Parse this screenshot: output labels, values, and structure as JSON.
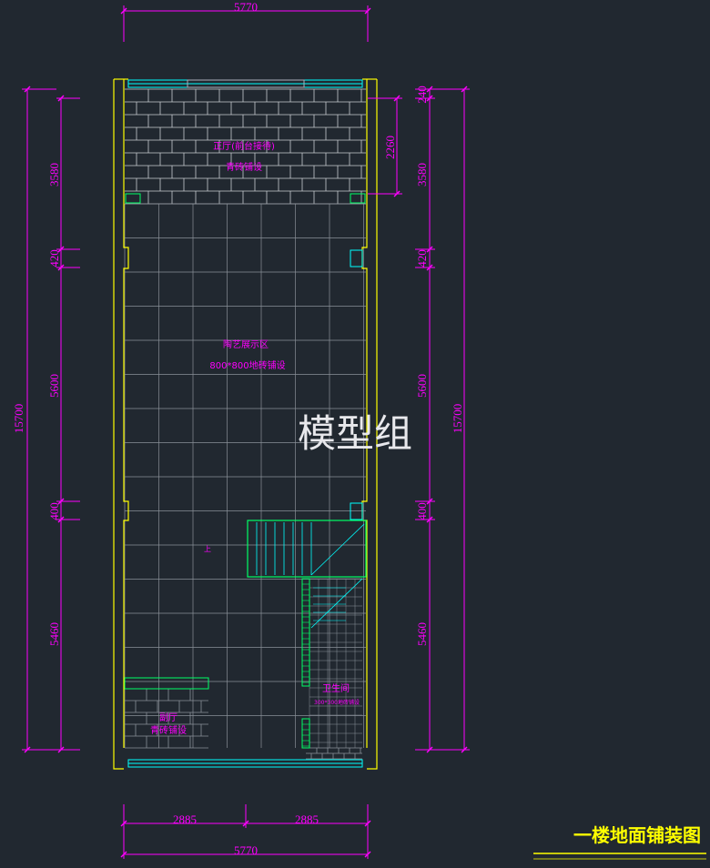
{
  "drawing": {
    "title": "一楼地面铺装图",
    "watermark": "模型组",
    "colors": {
      "background": "#212830",
      "dimension": "#ff00ff",
      "wall": "#ffff00",
      "window": "#00ffff",
      "grid": "#8a9099",
      "stair": "#00ff66",
      "text": "#ff00ff"
    }
  },
  "dimensions": {
    "top_total": "5770",
    "bottom_total": "5770",
    "bottom_left": "2885",
    "bottom_right": "2885",
    "left_total": "15700",
    "left_segments": [
      "3580",
      "420",
      "5600",
      "400",
      "5460"
    ],
    "right_total": "15700",
    "right_segments": [
      "240",
      "3580",
      "420",
      "5600",
      "400",
      "5460"
    ],
    "right_inner": "2260"
  },
  "rooms": {
    "reception": {
      "name": "正厅(前台接待)",
      "floor": "青砖铺设"
    },
    "exhibition": {
      "name": "陶艺展示区",
      "floor": "800*800地砖铺设"
    },
    "stair_label": "上",
    "bathroom": {
      "name": "卫生间",
      "floor": "300*300地砖铺设"
    },
    "side_hall": {
      "name": "副厅",
      "floor": "青砖铺设"
    }
  }
}
